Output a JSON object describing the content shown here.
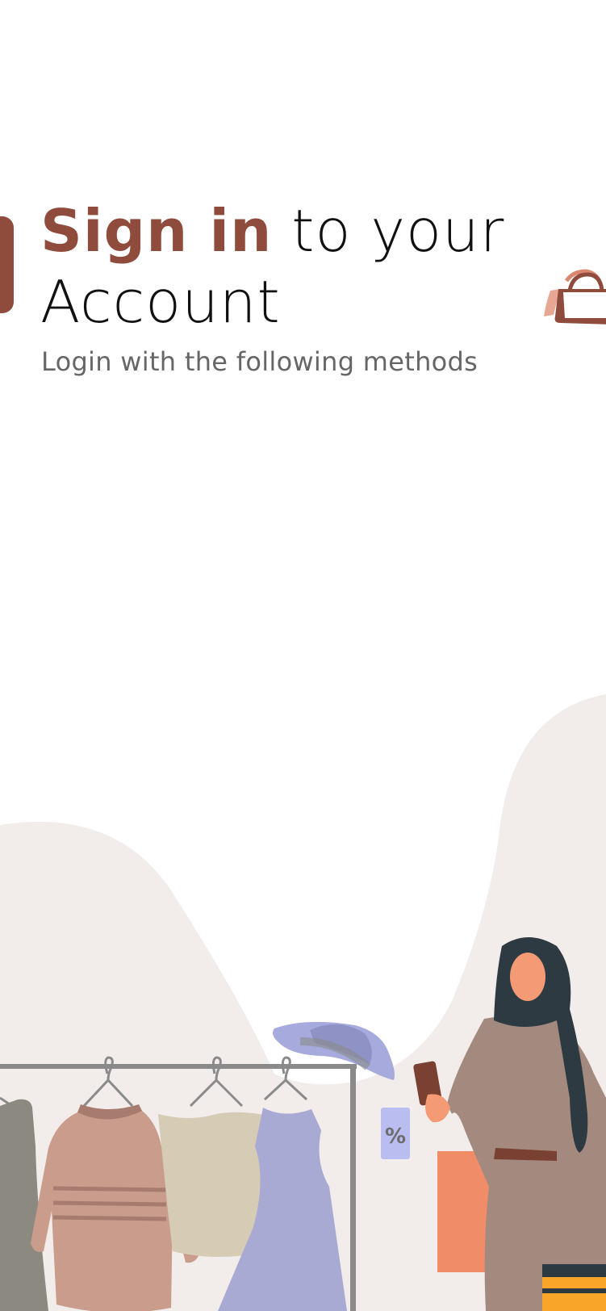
{
  "login": {
    "title_accent": "Sign in",
    "title_rest": " to your",
    "title_line2": "Account",
    "subtitle": "Login with the following methods"
  },
  "illustration": {
    "price_tag": "%"
  },
  "colors": {
    "accent": "#8f4c3d",
    "text": "#111111",
    "subtext": "#666666",
    "backdrop": "#f2ecea"
  },
  "icons": {
    "decor_tab": "side-tab",
    "bag": "shopping-bag-icon"
  }
}
